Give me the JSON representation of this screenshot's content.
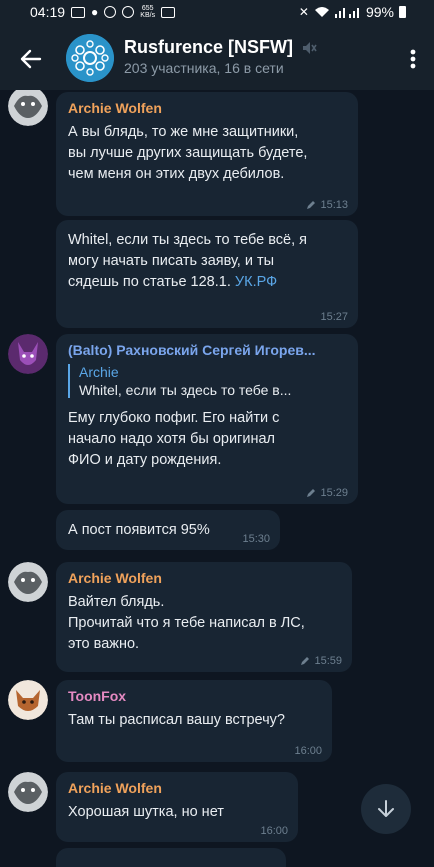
{
  "status_bar": {
    "time": "04:19",
    "net_speed": "655\nKB/s",
    "battery": "99%"
  },
  "header": {
    "title": "Rusfurence [NSFW]",
    "subtitle": "203 участника, 16 в сети",
    "icons": [
      "back-arrow-icon",
      "muted-speaker-icon",
      "more-vert-icon"
    ]
  },
  "messages": [
    {
      "sender": "Archie Wolfen",
      "sender_color": "#f0a25b",
      "text": "А вы блядь, то же мне защитники,\nвы лучше других защищать будете,\nчем меня он этих двух дебилов.",
      "time": "15:13",
      "edited": true
    },
    {
      "sender": "",
      "text_before_link": "Whitel, если ты здесь то тебе всё, я\nмогу начать писать заяву, и ты\nсядешь по статье 128.1. ",
      "link": "УК.РФ",
      "time": "15:27",
      "edited": false
    },
    {
      "sender": "(Balto) Рахновский Сергей Игорев...",
      "sender_color": "#7aa5ec",
      "reply": {
        "name": "Archie",
        "text": "Whitel, если ты здесь то тебе в..."
      },
      "text": "Ему глубоко пофиг. Его найти с\nначало надо хотя бы оригинал\nФИО и дату рождения.",
      "time": "15:29",
      "edited": true
    },
    {
      "sender": "",
      "text": "А пост появится 95%",
      "time": "15:30",
      "edited": false
    },
    {
      "sender": "Archie Wolfen",
      "sender_color": "#f0a25b",
      "text": "Вайтел блядь.\nПрочитай что я тебе написал в ЛС,\nэто важно.",
      "time": "15:59",
      "edited": true
    },
    {
      "sender": "ToonFox",
      "sender_color": "#e58ac2",
      "text": "Там ты расписал вашу встречу?",
      "time": "16:00",
      "edited": false
    },
    {
      "sender": "Archie Wolfen",
      "sender_color": "#f0a25b",
      "text": "Хорошая шутка, но нет",
      "time": "16:00",
      "edited": false
    }
  ],
  "colors": {
    "background": "#0e1621",
    "header": "#17212b",
    "bubble": "#182533",
    "accent": "#5aa6e6"
  }
}
